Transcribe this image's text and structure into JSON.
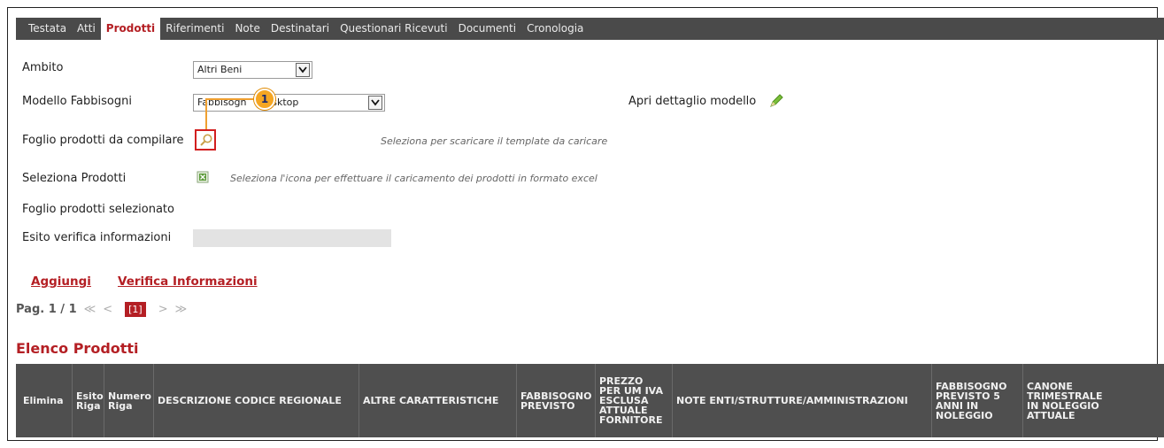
{
  "tabs": [
    {
      "label": "Testata",
      "active": false
    },
    {
      "label": "Atti",
      "active": false
    },
    {
      "label": "Prodotti",
      "active": true
    },
    {
      "label": "Riferimenti",
      "active": false
    },
    {
      "label": "Note",
      "active": false
    },
    {
      "label": "Destinatari",
      "active": false
    },
    {
      "label": "Questionari Ricevuti",
      "active": false
    },
    {
      "label": "Documenti",
      "active": false
    },
    {
      "label": "Cronologia",
      "active": false
    }
  ],
  "form": {
    "ambito": {
      "label": "Ambito",
      "value": "Altri Beni"
    },
    "modello": {
      "label": "Modello Fabbisogni",
      "value": "Fabbisogni Desktop",
      "visible_left": "Fabbisogn",
      "visible_right": "esktop"
    },
    "apri_dettaglio": {
      "label": "Apri dettaglio modello",
      "icon": "pencil-icon"
    },
    "foglio": {
      "label": "Foglio prodotti da compilare",
      "hint": "Seleziona per scaricare il template da caricare",
      "icon": "magnifier-icon"
    },
    "seleziona": {
      "label": "Seleziona Prodotti",
      "hint": "Seleziona l'icona per effettuare il caricamento dei prodotti in formato excel",
      "icon": "excel-icon"
    },
    "foglio_selezionato": {
      "label": "Foglio prodotti selezionato"
    },
    "esito": {
      "label": "Esito verifica informazioni",
      "value": ""
    }
  },
  "actions": {
    "aggiungi": "Aggiungi",
    "verifica": "Verifica Informazioni"
  },
  "pagination": {
    "label": "Pag. 1 / 1",
    "first": "≪",
    "prev": "<",
    "current": "[1]",
    "next": ">",
    "last": "≫"
  },
  "section_title": "Elenco Prodotti",
  "table": {
    "headers": [
      [
        "Elimina"
      ],
      [
        "Esito",
        "Riga"
      ],
      [
        "Numero",
        "Riga"
      ],
      [
        "DESCRIZIONE CODICE REGIONALE"
      ],
      [
        "ALTRE CARATTERISTICHE"
      ],
      [
        "FABBISOGNO",
        "PREVISTO"
      ],
      [
        "PREZZO",
        "PER UM IVA",
        "ESCLUSA",
        "ATTUALE",
        "FORNITORE"
      ],
      [
        "NOTE ENTI/STRUTTURE/AMMINISTRAZIONI"
      ],
      [
        "FABBISOGNO",
        "PREVISTO 5",
        "ANNI IN",
        "NOLEGGIO"
      ],
      [
        "CANONE",
        "TRIMESTRALE",
        "IN NOLEGGIO",
        "ATTUALE"
      ]
    ]
  },
  "annotation": {
    "badge": "1"
  },
  "colors": {
    "accent": "#b41f24",
    "tabbar": "#4a4a4a",
    "table_header": "#4f4f4f",
    "badge": "#f5a623"
  }
}
